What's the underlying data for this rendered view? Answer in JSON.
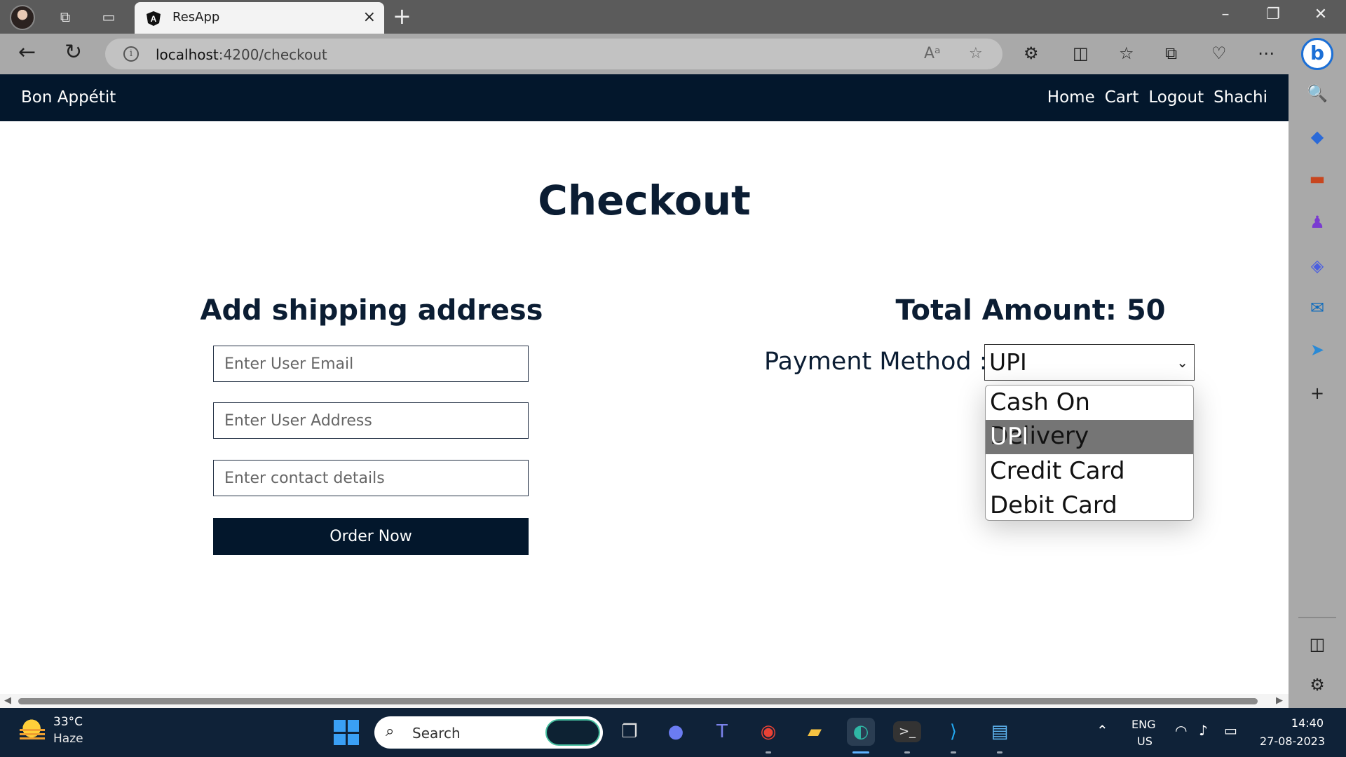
{
  "browser": {
    "tab_title": "ResApp",
    "url_host": "localhost",
    "url_port_path": ":4200/checkout",
    "close_tab_glyph": "×",
    "new_tab_glyph": "+"
  },
  "app": {
    "brand": "Bon Appétit",
    "nav": [
      "Home",
      "Cart",
      "Logout",
      "Shachi"
    ]
  },
  "checkout": {
    "title": "Checkout",
    "shipping_title": "Add shipping address",
    "email_placeholder": "Enter User Email",
    "address_placeholder": "Enter User Address",
    "contact_placeholder": "Enter contact details",
    "order_button": "Order Now",
    "total_label": "Total Amount: 50",
    "payment_label": "Payment Method :",
    "payment_selected": "UPI",
    "payment_options": [
      "Cash On Delivery",
      "UPI",
      "Credit Card",
      "Debit Card"
    ]
  },
  "taskbar": {
    "temperature": "33°C",
    "weather": "Haze",
    "search_label": "Search",
    "lang_line1": "ENG",
    "lang_line2": "US",
    "time": "14:40",
    "date": "27-08-2023"
  },
  "icons": {
    "profile": "profile-avatar-icon",
    "workspaces": "workspaces-icon",
    "tab_actions": "tab-actions-icon",
    "angular_favicon": "angular-icon",
    "bing": "bing-icon",
    "start": "windows-start-icon"
  },
  "colors": {
    "app_nav": "#03172c",
    "heading_text": "#0b1d33",
    "selected_option": "#757575",
    "taskbar": "#0f2238"
  }
}
